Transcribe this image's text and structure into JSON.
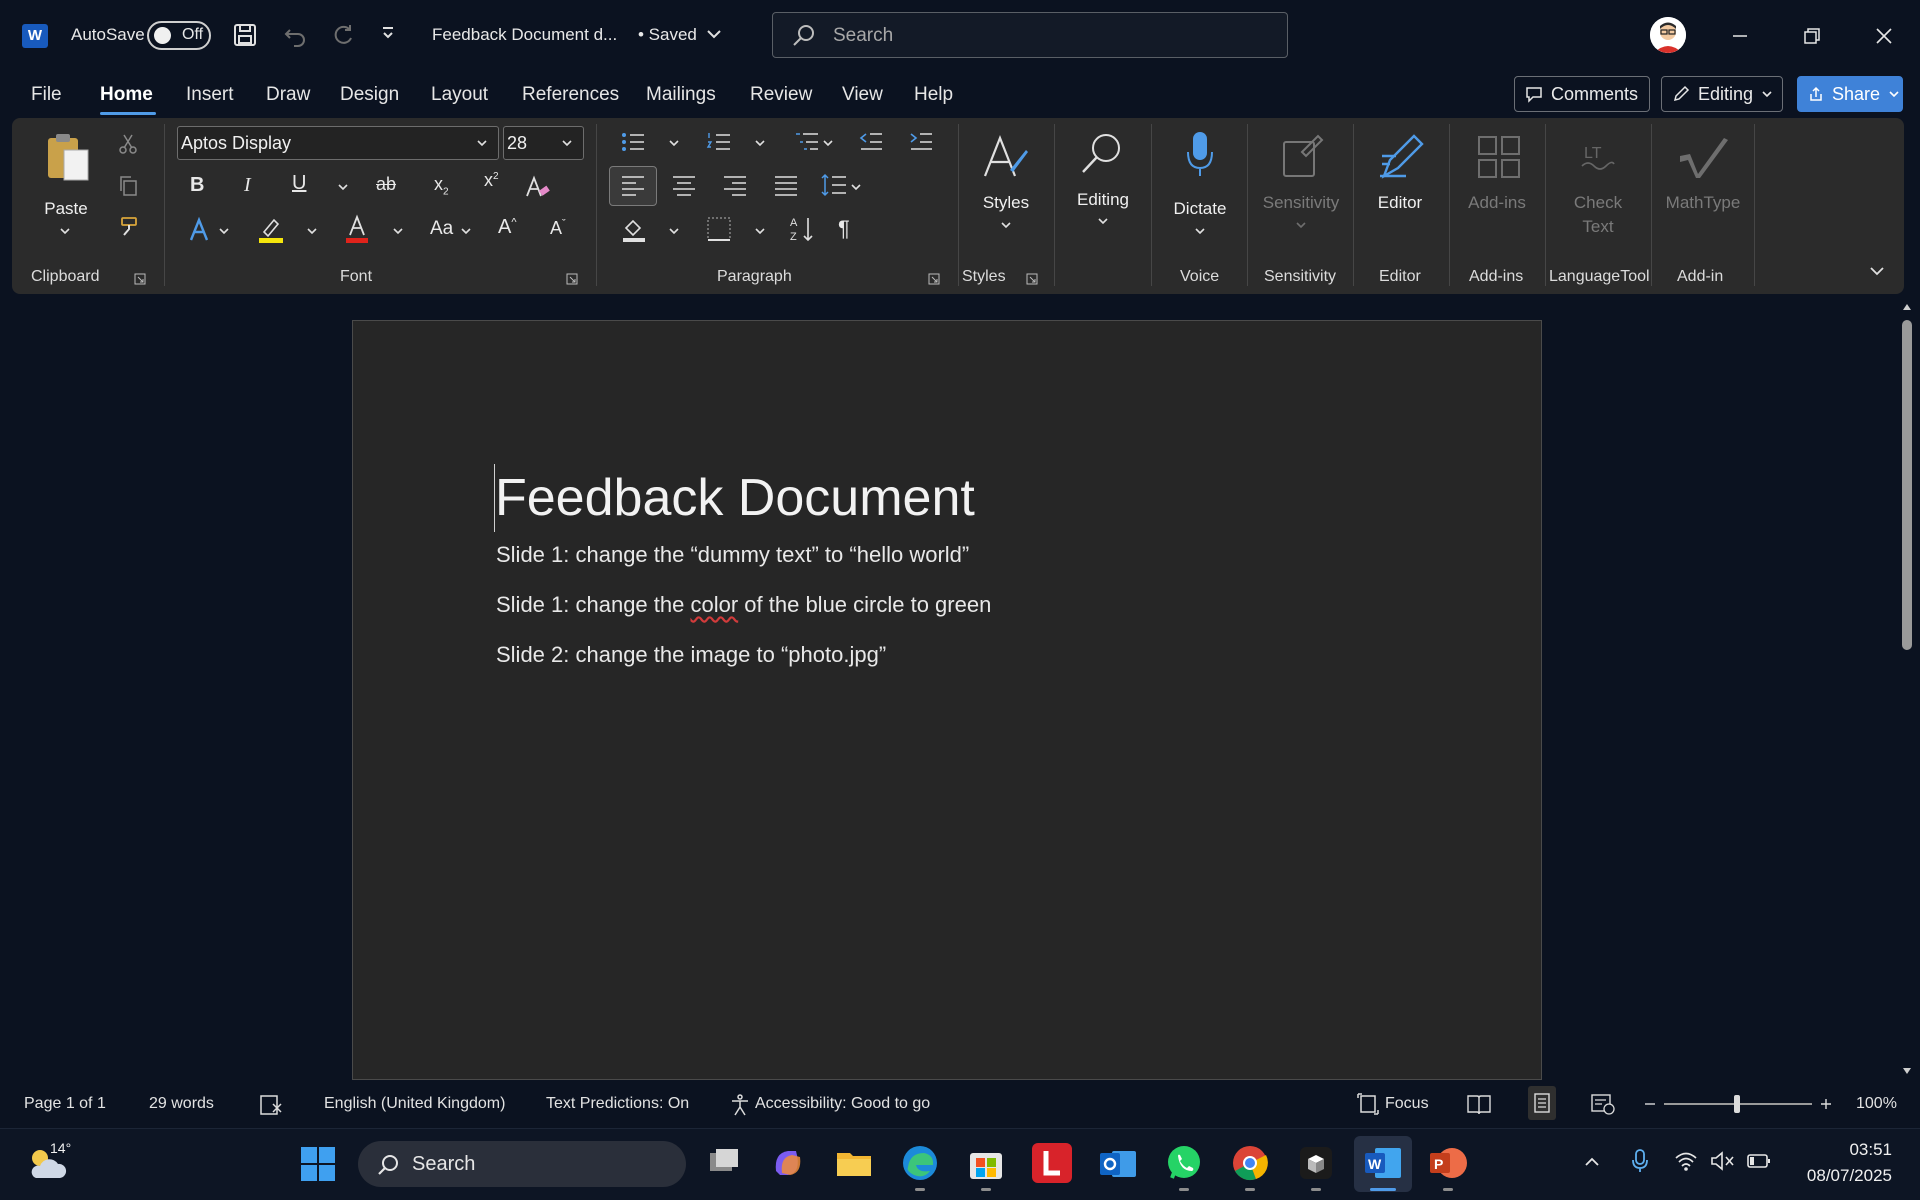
{
  "titlebar": {
    "autosave_label": "AutoSave",
    "autosave_state": "Off",
    "doc_title": "Feedback Document d...",
    "saved_status": "• Saved",
    "search_placeholder": "Search"
  },
  "menu": {
    "items": [
      "File",
      "Home",
      "Insert",
      "Draw",
      "Design",
      "Layout",
      "References",
      "Mailings",
      "Review",
      "View",
      "Help"
    ],
    "active": "Home",
    "comments_label": "Comments",
    "editing_label": "Editing",
    "share_label": "Share"
  },
  "ribbon": {
    "font_name": "Aptos Display",
    "font_size": "28",
    "paste_label": "Paste",
    "styles_label": "Styles",
    "editing_label": "Editing",
    "dictate_label": "Dictate",
    "sensitivity_label": "Sensitivity",
    "editor_label": "Editor",
    "addins_label": "Add-ins",
    "check_text_label_1": "Check",
    "check_text_label_2": "Text",
    "mathtype_label": "MathType",
    "groups": {
      "clipboard": "Clipboard",
      "font": "Font",
      "paragraph": "Paragraph",
      "styles": "Styles",
      "voice": "Voice",
      "sensitivity": "Sensitivity",
      "editor": "Editor",
      "addins": "Add-ins",
      "languagetool": "LanguageTool",
      "addin": "Add-in"
    }
  },
  "document": {
    "title": "Feedback Document",
    "line1": "Slide 1: change the “dummy text” to “hello world”",
    "line2_before": "Slide 1: change the ",
    "line2_misspelled": "color",
    "line2_after": " of the blue circle to green",
    "line3": "Slide 2: change the image to “photo.jpg”"
  },
  "status": {
    "page": "Page 1 of 1",
    "words": "29 words",
    "language": "English (United Kingdom)",
    "predictions": "Text Predictions: On",
    "accessibility": "Accessibility: Good to go",
    "focus": "Focus",
    "zoom": "100%"
  },
  "taskbar": {
    "weather_temp": "14°",
    "search_placeholder": "Search",
    "time": "03:51",
    "date": "08/07/2025"
  },
  "colors": {
    "accent": "#3f82d8",
    "word_blue": "#185abd",
    "ribbon_bg": "#2b2b2b",
    "page_bg": "#262626",
    "app_bg": "#0b1220"
  }
}
